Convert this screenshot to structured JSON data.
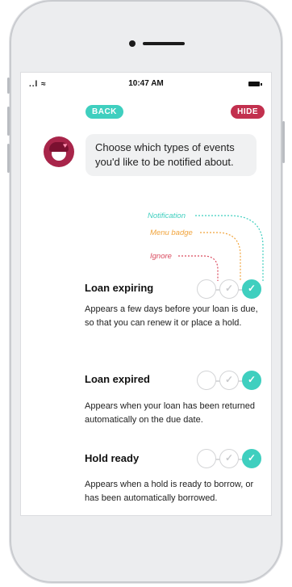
{
  "status": {
    "signal": "..l ≈",
    "time": "10:47 AM"
  },
  "nav": {
    "back_label": "BACK",
    "hide_label": "HIDE"
  },
  "message": {
    "text": "Choose which types of events you'd like to be notified about."
  },
  "legend": {
    "notification": "Notification",
    "menu_badge": "Menu badge",
    "ignore": "Ignore"
  },
  "colors": {
    "accent_teal": "#3fcfbf",
    "accent_red": "#c2304e",
    "legend_orange": "#f1a43c",
    "legend_red": "#d94a5e"
  },
  "events": [
    {
      "title": "Loan expiring",
      "description": "Appears a few days before your loan is due, so that you can renew it or place a hold.",
      "selected": "Notification",
      "check_glyph": "✓"
    },
    {
      "title": "Loan expired",
      "description": "Appears when your loan has been returned automatically on the due date.",
      "selected": "Notification",
      "check_glyph": "✓"
    },
    {
      "title": "Hold ready",
      "description": "Appears when a hold is ready to borrow, or has been automatically borrowed.",
      "selected": "Notification",
      "check_glyph": "✓"
    }
  ]
}
